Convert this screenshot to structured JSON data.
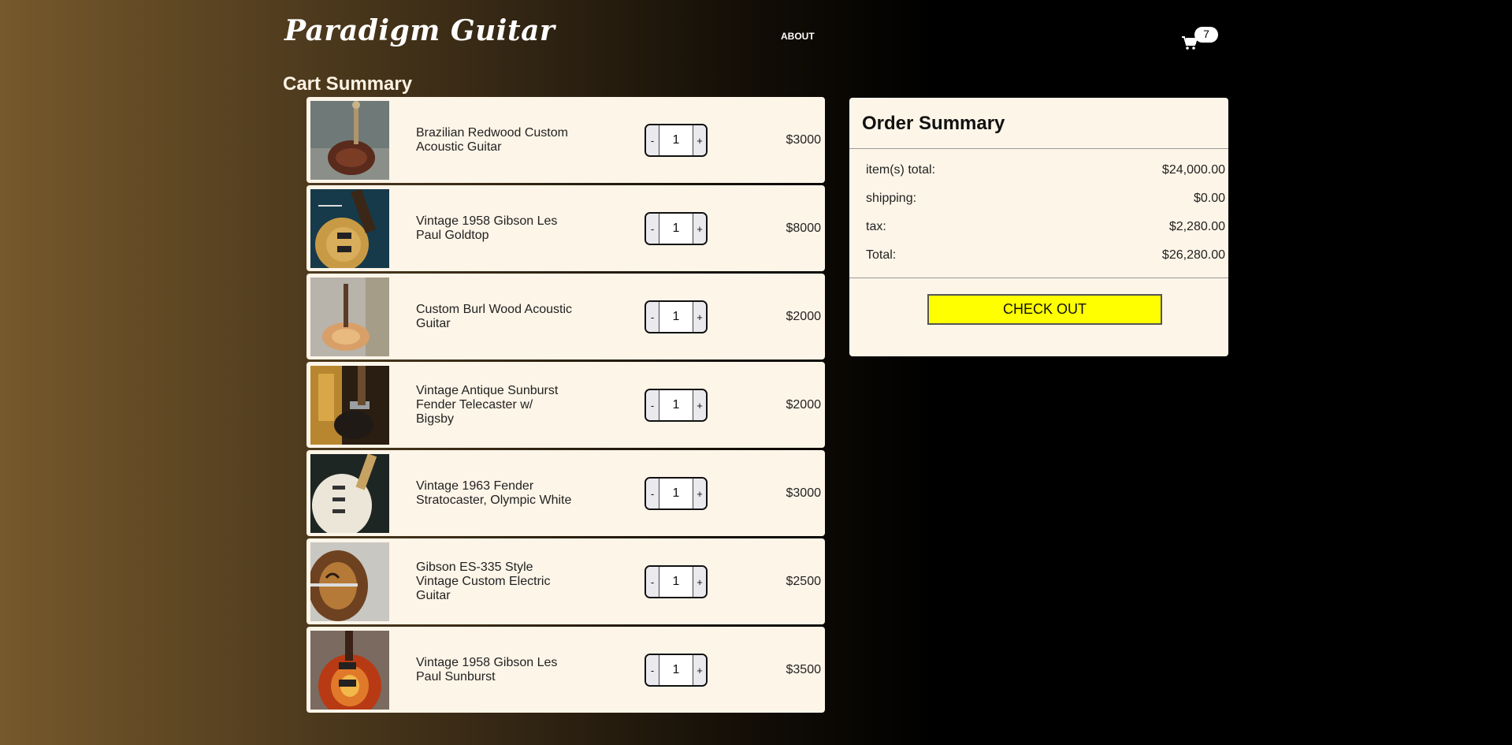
{
  "header": {
    "logo": "Paradigm Guitar",
    "nav_about": "ABOUT",
    "cart_count": "7"
  },
  "cart": {
    "title": "Cart Summary",
    "items": [
      {
        "name": "Brazilian Redwood Custom Acoustic Guitar",
        "qty": "1",
        "price": "$3000",
        "minus": "-",
        "plus": "+"
      },
      {
        "name": "Vintage 1958 Gibson Les Paul Goldtop",
        "qty": "1",
        "price": "$8000",
        "minus": "-",
        "plus": "+"
      },
      {
        "name": "Custom Burl Wood Acoustic Guitar",
        "qty": "1",
        "price": "$2000",
        "minus": "-",
        "plus": "+"
      },
      {
        "name": "Vintage Antique Sunburst Fender Telecaster w/ Bigsby",
        "qty": "1",
        "price": "$2000",
        "minus": "-",
        "plus": "+"
      },
      {
        "name": "Vintage 1963 Fender Stratocaster, Olympic White",
        "qty": "1",
        "price": "$3000",
        "minus": "-",
        "plus": "+"
      },
      {
        "name": "Gibson ES-335 Style Vintage Custom Electric Guitar",
        "qty": "1",
        "price": "$2500",
        "minus": "-",
        "plus": "+"
      },
      {
        "name": "Vintage 1958 Gibson Les Paul Sunburst",
        "qty": "1",
        "price": "$3500",
        "minus": "-",
        "plus": "+"
      }
    ]
  },
  "order_summary": {
    "title": "Order Summary",
    "rows": [
      {
        "label": "item(s) total:",
        "value": "$24,000.00"
      },
      {
        "label": "shipping:",
        "value": "$0.00"
      },
      {
        "label": "tax:",
        "value": "$2,280.00"
      },
      {
        "label": "Total:",
        "value": "$26,280.00"
      }
    ],
    "checkout_label": "CHECK OUT"
  },
  "colors": {
    "panel_bg": "#fdf5e8",
    "checkout_bg": "#ffff00",
    "gradient_start": "#76592c"
  },
  "icons": {
    "cart": "shopping-cart-icon"
  }
}
